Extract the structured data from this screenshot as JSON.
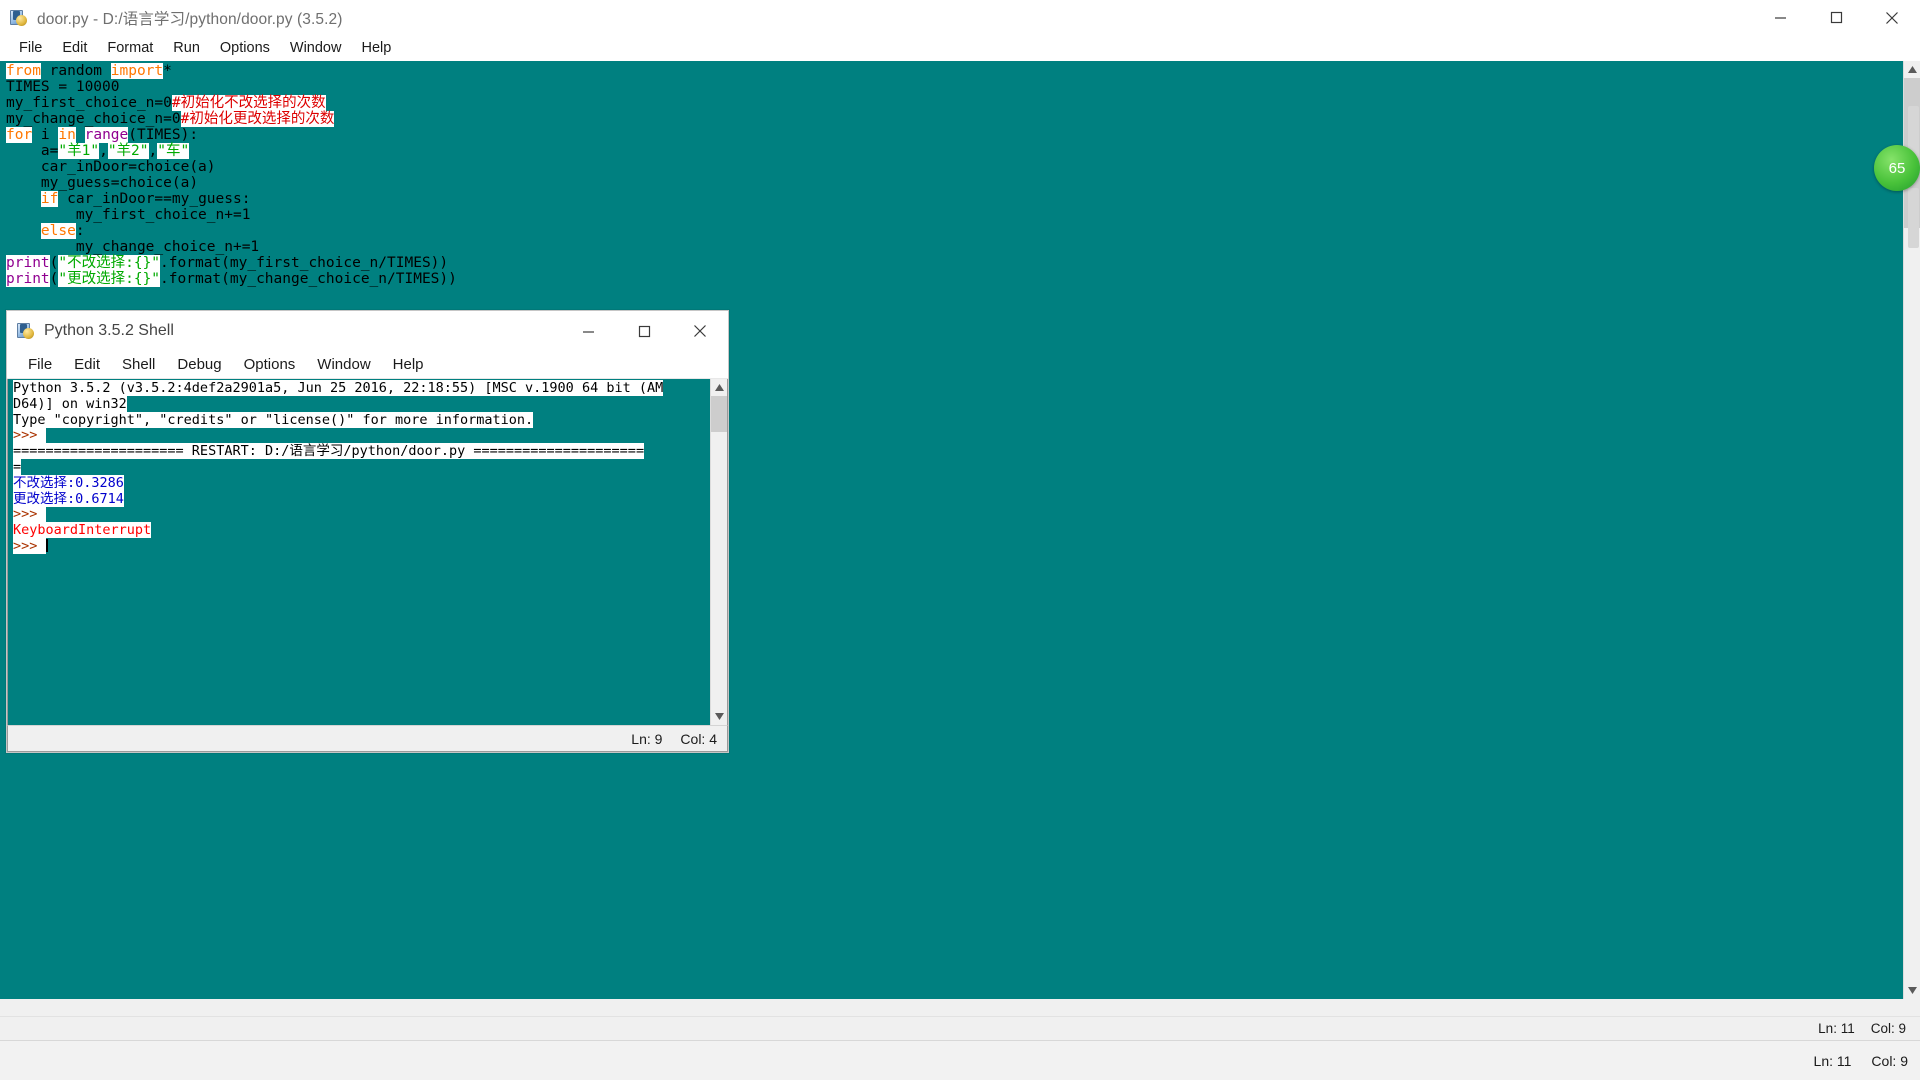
{
  "editor": {
    "title": "door.py - D:/语言学习/python/door.py (3.5.2)",
    "icon": "python-idle-icon",
    "window_buttons": {
      "minimize": "minimize-icon",
      "maximize": "maximize-icon",
      "close": "close-icon"
    },
    "menu": [
      "File",
      "Edit",
      "Format",
      "Run",
      "Options",
      "Window",
      "Help"
    ],
    "code_lines": [
      [
        {
          "t": "kw",
          "s": "from"
        },
        {
          "t": "plain",
          "s": " random "
        },
        {
          "t": "kw",
          "s": "import"
        },
        {
          "t": "plain",
          "s": "*"
        }
      ],
      [
        {
          "t": "plain",
          "s": "TIMES = 10000"
        }
      ],
      [
        {
          "t": "plain",
          "s": "my_first_choice_n=0"
        },
        {
          "t": "cmt",
          "s": "#初始化不改选择的次数"
        }
      ],
      [
        {
          "t": "plain",
          "s": "my_change_choice_n=0"
        },
        {
          "t": "cmt",
          "s": "#初始化更改选择的次数"
        }
      ],
      [
        {
          "t": "kw",
          "s": "for"
        },
        {
          "t": "plain",
          "s": " i "
        },
        {
          "t": "kw",
          "s": "in"
        },
        {
          "t": "plain",
          "s": " "
        },
        {
          "t": "bi",
          "s": "range"
        },
        {
          "t": "plain",
          "s": "(TIMES):"
        }
      ],
      [
        {
          "t": "plain",
          "s": "    a="
        },
        {
          "t": "str",
          "s": "\"羊1\""
        },
        {
          "t": "plain",
          "s": ","
        },
        {
          "t": "str",
          "s": "\"羊2\""
        },
        {
          "t": "plain",
          "s": ","
        },
        {
          "t": "str",
          "s": "\"车\""
        }
      ],
      [
        {
          "t": "plain",
          "s": "    car_inDoor=choice(a)"
        }
      ],
      [
        {
          "t": "plain",
          "s": "    my_guess=choice(a)"
        }
      ],
      [
        {
          "t": "plain",
          "s": "    "
        },
        {
          "t": "kw",
          "s": "if"
        },
        {
          "t": "plain",
          "s": " car_inDoor==my_guess:"
        }
      ],
      [
        {
          "t": "plain",
          "s": "        my_first_choice_n+=1"
        }
      ],
      [
        {
          "t": "plain",
          "s": "    "
        },
        {
          "t": "kw",
          "s": "else"
        },
        {
          "t": "plain",
          "s": ":"
        }
      ],
      [
        {
          "t": "plain",
          "s": "        my_change_choice_n+=1"
        }
      ],
      [
        {
          "t": "bi",
          "s": "print"
        },
        {
          "t": "plain",
          "s": "("
        },
        {
          "t": "str",
          "s": "\"不改选择:{}\""
        },
        {
          "t": "plain",
          "s": ".format(my_first_choice_n/TIMES))"
        }
      ],
      [
        {
          "t": "bi",
          "s": "print"
        },
        {
          "t": "plain",
          "s": "("
        },
        {
          "t": "str",
          "s": "\"更改选择:{}\""
        },
        {
          "t": "plain",
          "s": ".format(my_change_choice_n/TIMES))"
        }
      ]
    ],
    "status": {
      "line_label": "Ln: 11",
      "col_label": "Col: 9"
    }
  },
  "shell": {
    "title": "Python 3.5.2 Shell",
    "icon": "python-idle-icon",
    "window_buttons": {
      "minimize": "minimize-icon",
      "maximize": "maximize-icon",
      "close": "close-icon"
    },
    "menu": [
      "File",
      "Edit",
      "Shell",
      "Debug",
      "Options",
      "Window",
      "Help"
    ],
    "lines": [
      {
        "t": "plain",
        "s": "Python 3.5.2 (v3.5.2:4def2a2901a5, Jun 25 2016, 22:18:55) [MSC v.1900 64 bit (AM"
      },
      {
        "t": "plain",
        "s": "D64)] on win32"
      },
      {
        "t": "plain",
        "s": "Type \"copyright\", \"credits\" or \"license()\" for more information."
      },
      {
        "t": "prompt",
        "s": ">>> "
      },
      {
        "t": "plain",
        "s": "===================== RESTART: D:/语言学习/python/door.py ====================="
      },
      {
        "t": "plain",
        "s": "="
      },
      {
        "t": "out",
        "s": "不改选择:0.3286"
      },
      {
        "t": "out",
        "s": "更改选择:0.6714"
      },
      {
        "t": "prompt",
        "s": ">>> "
      },
      {
        "t": "err",
        "s": "KeyboardInterrupt"
      },
      {
        "t": "prompt-caret",
        "s": ">>> "
      }
    ],
    "status": {
      "line_label": "Ln: 9",
      "col_label": "Col: 4"
    }
  },
  "float_widget": {
    "label": "65",
    "name": "floating-score-badge"
  },
  "taskbar": {
    "line_label": "Ln: 11",
    "col_label": "Col: 9"
  },
  "colors": {
    "desktop": "#008080",
    "keyword": "#ff7700",
    "builtin": "#900090",
    "string": "#00aa00",
    "comment": "#dd0000",
    "output": "#0000cc",
    "error": "#ff0000",
    "prompt": "#aa3300"
  }
}
